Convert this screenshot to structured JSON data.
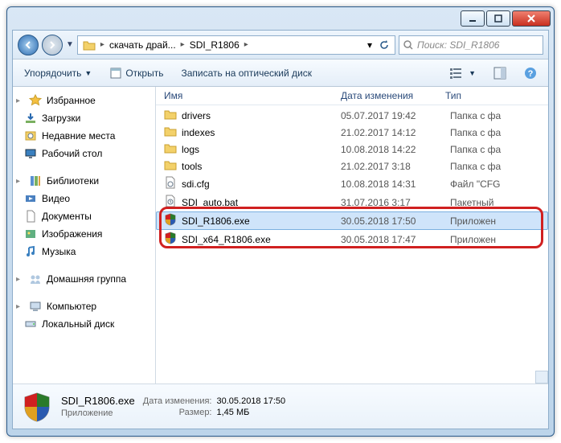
{
  "breadcrumb": {
    "parent": "скачать драй...",
    "current": "SDI_R1806"
  },
  "search": {
    "placeholder": "Поиск: SDI_R1806"
  },
  "toolbar": {
    "organize": "Упорядочить",
    "open": "Открыть",
    "burn": "Записать на оптический диск"
  },
  "columns": {
    "name": "Имя",
    "date": "Дата изменения",
    "type": "Тип"
  },
  "sidebar": {
    "favorites": {
      "label": "Избранное",
      "items": [
        "Загрузки",
        "Недавние места",
        "Рабочий стол"
      ]
    },
    "libraries": {
      "label": "Библиотеки",
      "items": [
        "Видео",
        "Документы",
        "Изображения",
        "Музыка"
      ]
    },
    "homegroup": "Домашняя группа",
    "computer": {
      "label": "Компьютер",
      "items": [
        "Локальный диск"
      ]
    }
  },
  "files": [
    {
      "icon": "folder",
      "name": "drivers",
      "date": "05.07.2017 19:42",
      "type": "Папка с фа"
    },
    {
      "icon": "folder",
      "name": "indexes",
      "date": "21.02.2017 14:12",
      "type": "Папка с фа"
    },
    {
      "icon": "folder",
      "name": "logs",
      "date": "10.08.2018 14:22",
      "type": "Папка с фа"
    },
    {
      "icon": "folder",
      "name": "tools",
      "date": "21.02.2017 3:18",
      "type": "Папка с фа"
    },
    {
      "icon": "cfg",
      "name": "sdi.cfg",
      "date": "10.08.2018 14:31",
      "type": "Файл \"CFG"
    },
    {
      "icon": "bat",
      "name": "SDI_auto.bat",
      "date": "31.07.2016 3:17",
      "type": "Пакетный"
    },
    {
      "icon": "exe",
      "name": "SDI_R1806.exe",
      "date": "30.05.2018 17:50",
      "type": "Приложен",
      "selected": true
    },
    {
      "icon": "exe",
      "name": "SDI_x64_R1806.exe",
      "date": "30.05.2018 17:47",
      "type": "Приложен"
    }
  ],
  "status": {
    "filename": "SDI_R1806.exe",
    "filetype": "Приложение",
    "date_label": "Дата изменения:",
    "date_value": "30.05.2018 17:50",
    "size_label": "Размер:",
    "size_value": "1,45 МБ"
  }
}
